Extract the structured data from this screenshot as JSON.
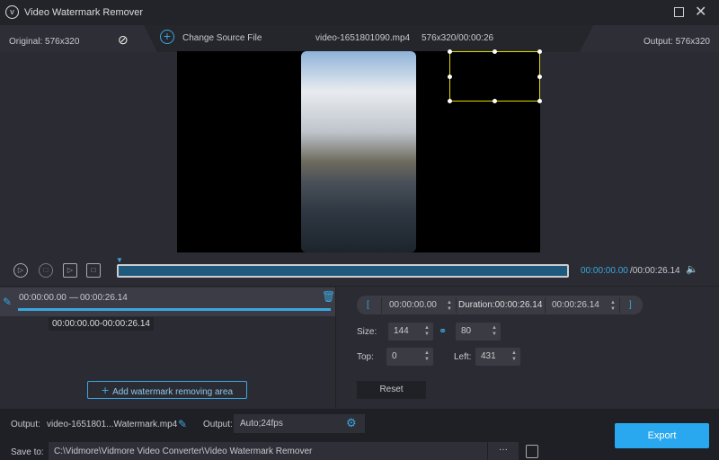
{
  "app": {
    "title": "Video Watermark Remover"
  },
  "info": {
    "original": "Original: 576x320",
    "change_source": "Change Source File",
    "filename": "video-1651801090.mp4",
    "meta": "576x320/00:00:26",
    "output": "Output: 576x320"
  },
  "timeline": {
    "current": "00:00:00.00",
    "total": "/00:00:26.14",
    "progress": 0
  },
  "segment": {
    "range_start": "00:00:00.00",
    "dash": "—",
    "range_end": "00:00:26.14",
    "tooltip": "00:00:00.00-00:00:26.14",
    "add_label": "Add watermark removing area"
  },
  "settings": {
    "bracket_open": "[",
    "start": "00:00:00.00",
    "duration": "Duration:00:00:26.14",
    "end": "00:00:26.14",
    "bracket_close": "]",
    "size_label": "Size:",
    "width": "144",
    "height": "80",
    "top_label": "Top:",
    "top": "0",
    "left_label": "Left:",
    "left": "431",
    "reset": "Reset"
  },
  "bottom": {
    "output_label": "Output:",
    "output_file": "video-1651801...Watermark.mp4",
    "format_label": "Output:",
    "format": "Auto;24fps",
    "save_label": "Save to:",
    "save_path": "C:\\Vidmore\\Vidmore Video Converter\\Video Watermark Remover",
    "more": "···",
    "export": "Export"
  },
  "colors": {
    "accent": "#3aa6e0",
    "export": "#29a8f0",
    "watermark_box": "#e0d800"
  }
}
